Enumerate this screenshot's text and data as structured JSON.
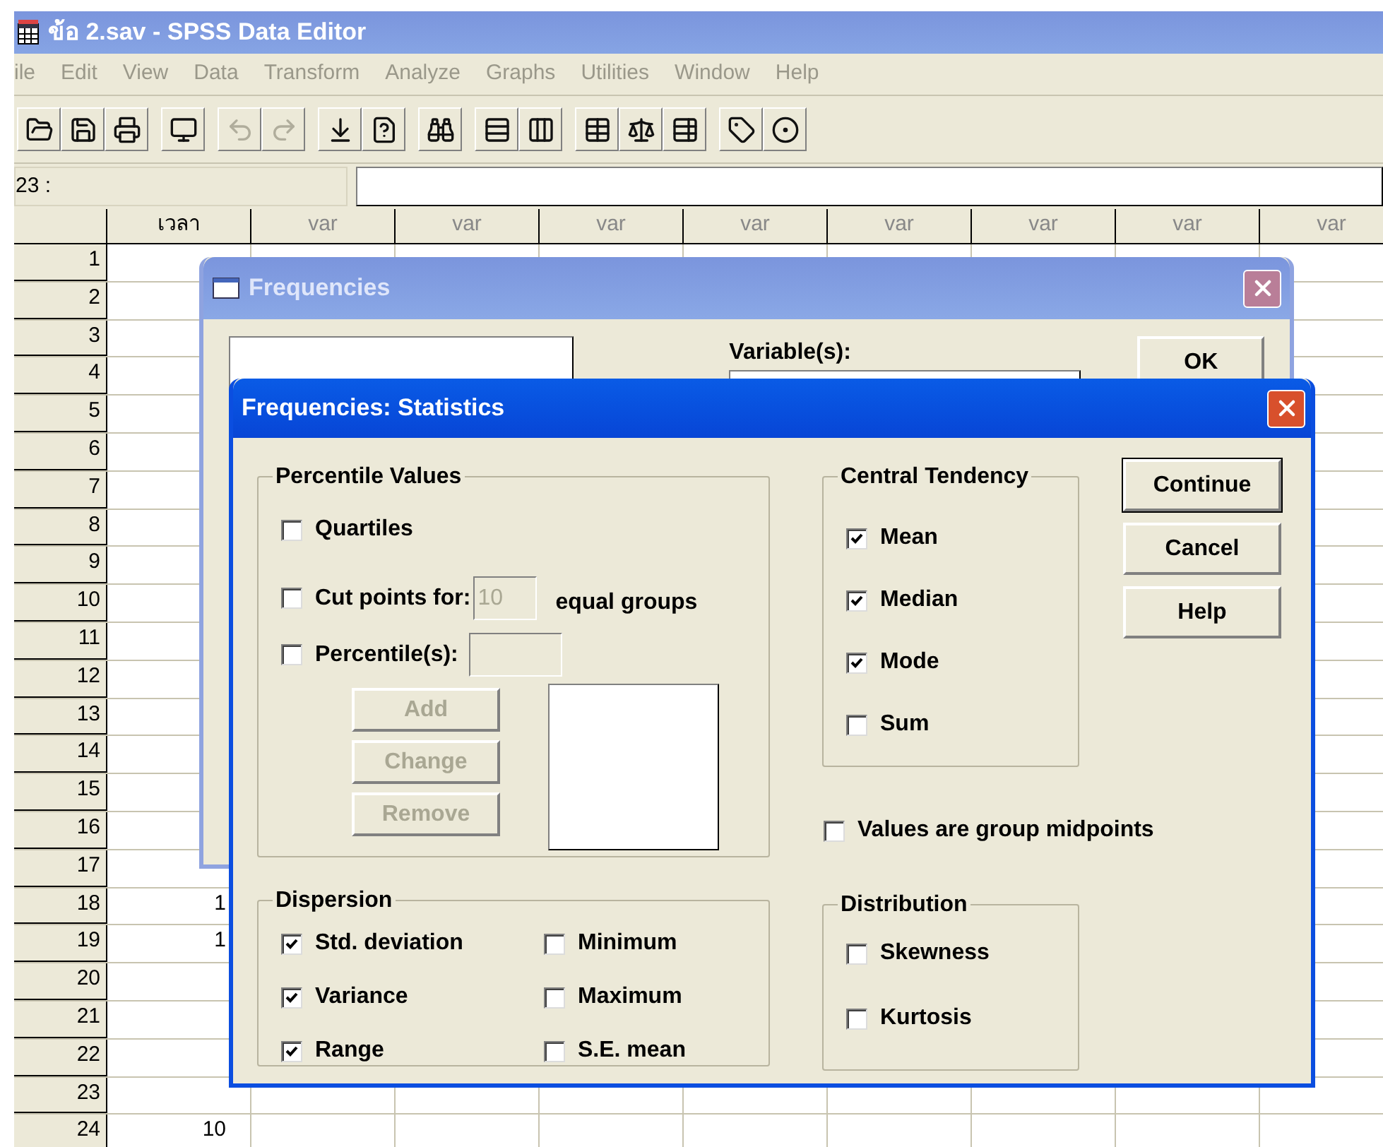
{
  "window": {
    "title": "ข้อ 2.sav - SPSS Data Editor"
  },
  "menu": [
    "ile",
    "Edit",
    "View",
    "Data",
    "Transform",
    "Analyze",
    "Graphs",
    "Utilities",
    "Window",
    "Help"
  ],
  "toolbar": [
    {
      "kind": "open",
      "disabled": false
    },
    {
      "kind": "save",
      "disabled": false
    },
    {
      "kind": "print",
      "disabled": false
    },
    {
      "kind": "recall",
      "disabled": false
    },
    {
      "kind": "undo",
      "disabled": true
    },
    {
      "kind": "redo",
      "disabled": true
    },
    {
      "kind": "goto",
      "disabled": false
    },
    {
      "kind": "variables",
      "disabled": false
    },
    {
      "kind": "find",
      "disabled": false
    },
    {
      "kind": "insert_case",
      "disabled": false
    },
    {
      "kind": "insert_variable",
      "disabled": false
    },
    {
      "kind": "split",
      "disabled": false
    },
    {
      "kind": "weight",
      "disabled": false
    },
    {
      "kind": "select",
      "disabled": false
    },
    {
      "kind": "labels",
      "disabled": false
    },
    {
      "kind": "sets",
      "disabled": false
    }
  ],
  "cell_ref": "23 :",
  "columns": [
    "เวลา",
    "var",
    "var",
    "var",
    "var",
    "var",
    "var",
    "var",
    "var"
  ],
  "rows": [
    {
      "number": "1"
    },
    {
      "number": "2"
    },
    {
      "number": "3"
    },
    {
      "number": "4"
    },
    {
      "number": "5"
    },
    {
      "number": "6"
    },
    {
      "number": "7"
    },
    {
      "number": "8"
    },
    {
      "number": "9"
    },
    {
      "number": "10"
    },
    {
      "number": "11"
    },
    {
      "number": "12"
    },
    {
      "number": "13"
    },
    {
      "number": "14"
    },
    {
      "number": "15"
    },
    {
      "number": "16"
    },
    {
      "number": "17"
    },
    {
      "number": "18",
      "value": "1"
    },
    {
      "number": "19",
      "value": "1"
    },
    {
      "number": "20"
    },
    {
      "number": "21"
    },
    {
      "number": "22"
    },
    {
      "number": "23"
    },
    {
      "number": "24",
      "value": "10"
    }
  ],
  "frequencies_dialog": {
    "title": "Frequencies",
    "variables_label": "Variable(s):",
    "ok_button": "OK"
  },
  "statistics_dialog": {
    "title": "Frequencies: Statistics",
    "percentile_values": {
      "title": "Percentile Values",
      "quartiles": {
        "label": "Quartiles",
        "checked": false
      },
      "cut_points": {
        "label": "Cut points for:",
        "checked": false,
        "value": "10",
        "suffix": "equal groups"
      },
      "percentiles": {
        "label": "Percentile(s):",
        "checked": false
      },
      "buttons": [
        {
          "label": "Add",
          "disabled": true
        },
        {
          "label": "Change",
          "disabled": true
        },
        {
          "label": "Remove",
          "disabled": true
        }
      ]
    },
    "central_tendency": {
      "title": "Central Tendency",
      "items": [
        {
          "label": "Mean",
          "checked": true
        },
        {
          "label": "Median",
          "checked": true
        },
        {
          "label": "Mode",
          "checked": true
        },
        {
          "label": "Sum",
          "checked": false
        }
      ]
    },
    "buttons": [
      {
        "label": "Continue",
        "default": true
      },
      {
        "label": "Cancel",
        "default": false
      },
      {
        "label": "Help",
        "default": false
      }
    ],
    "group_midpoints": {
      "label": "Values are group midpoints",
      "checked": false
    },
    "dispersion": {
      "title": "Dispersion",
      "items": [
        {
          "label": "Std. deviation",
          "checked": true
        },
        {
          "label": "Minimum",
          "checked": false
        },
        {
          "label": "Variance",
          "checked": true
        },
        {
          "label": "Maximum",
          "checked": false
        },
        {
          "label": "Range",
          "checked": true
        },
        {
          "label": "S.E. mean",
          "checked": false
        }
      ]
    },
    "distribution": {
      "title": "Distribution",
      "items": [
        {
          "label": "Skewness",
          "checked": false
        },
        {
          "label": "Kurtosis",
          "checked": false
        }
      ]
    }
  }
}
